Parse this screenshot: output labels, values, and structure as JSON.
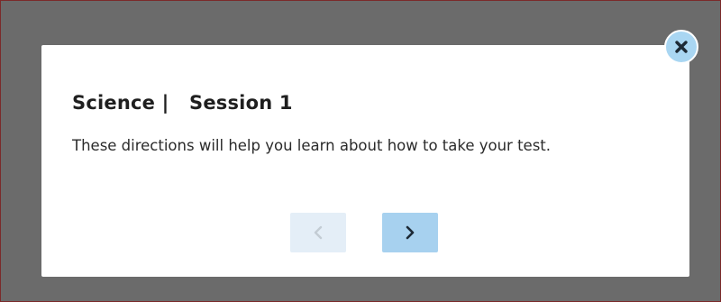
{
  "dialog": {
    "subject": "Science",
    "separator": "|",
    "session": "Session 1",
    "body": "These directions will help you learn about how to take your test."
  },
  "icons": {
    "close": "close-icon",
    "previous": "chevron-left-icon",
    "next": "chevron-right-icon"
  },
  "colors": {
    "overlay": "#6b6b6b",
    "close_button": "#a9d6f2",
    "next_button": "#a7d1ef",
    "prev_button_disabled": "#e4eef7"
  },
  "navigation": {
    "previous_enabled": false,
    "next_enabled": true
  }
}
